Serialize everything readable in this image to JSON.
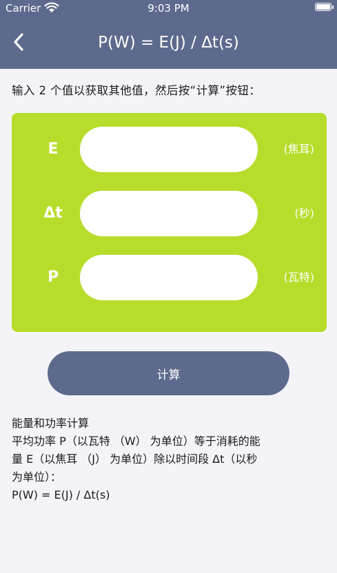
{
  "status_bar": {
    "carrier": "Carrier",
    "time": "9:03 PM",
    "wifi_icon": "wifi-icon",
    "battery_icon": "battery-icon"
  },
  "header": {
    "title": "P(W) = E(J) / Δt(s)",
    "back_icon": "chevron-left-icon",
    "background_color": "#5e6a8d"
  },
  "instruction": "输入 2 个值以获取其他值，然后按“计算”按钮：",
  "panel": {
    "background_color": "#b7dd2c",
    "fields": [
      {
        "label": "E",
        "value": "",
        "unit": "(焦耳)"
      },
      {
        "label": "Δt",
        "value": "",
        "unit": "(秒)"
      },
      {
        "label": "P",
        "value": "",
        "unit": "(瓦特)"
      }
    ]
  },
  "calculate_button": "计算",
  "description": {
    "lines": [
      "能量和功率计算",
      "平均功率 P（以瓦特 （W） 为单位）等于消耗的能",
      "量 E（以焦耳 （J） 为单位）除以时间段 Δt（以秒",
      "为单位）：",
      "P(W) = E(J) / Δt(s)"
    ]
  }
}
